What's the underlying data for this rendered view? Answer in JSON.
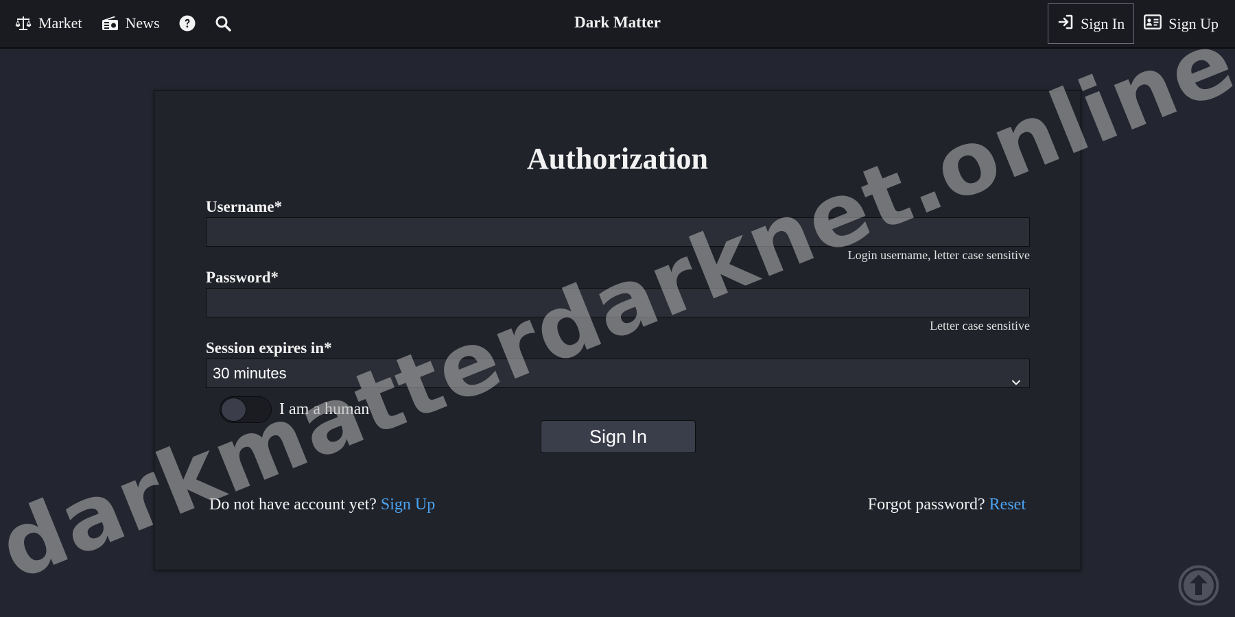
{
  "nav": {
    "market_label": "Market",
    "news_label": "News",
    "site_title": "Dark Matter",
    "signin_label": "Sign In",
    "signup_label": "Sign Up"
  },
  "form": {
    "title": "Authorization",
    "username_label": "Username*",
    "username_value": "",
    "username_hint": "Login username, letter case sensitive",
    "password_label": "Password*",
    "password_value": "",
    "password_hint": "Letter case sensitive",
    "session_label": "Session expires in*",
    "session_value": "30 minutes",
    "human_label": "I am a human",
    "human_checked": false,
    "submit_label": "Sign In",
    "no_account_text": "Do not have account yet?",
    "signup_link": "Sign Up",
    "forgot_text": "Forgot password?",
    "reset_link": "Reset"
  },
  "watermark": "darkmatterdarknet.online",
  "colors": {
    "background": "#232630",
    "navbar": "#191b21",
    "card": "#21232b",
    "link": "#4aa3f0"
  },
  "icons": [
    "scales-icon",
    "radio-icon",
    "help-icon",
    "search-icon",
    "sign-in-icon",
    "id-card-icon",
    "chevron-down-icon",
    "arrow-up-circle-icon"
  ]
}
